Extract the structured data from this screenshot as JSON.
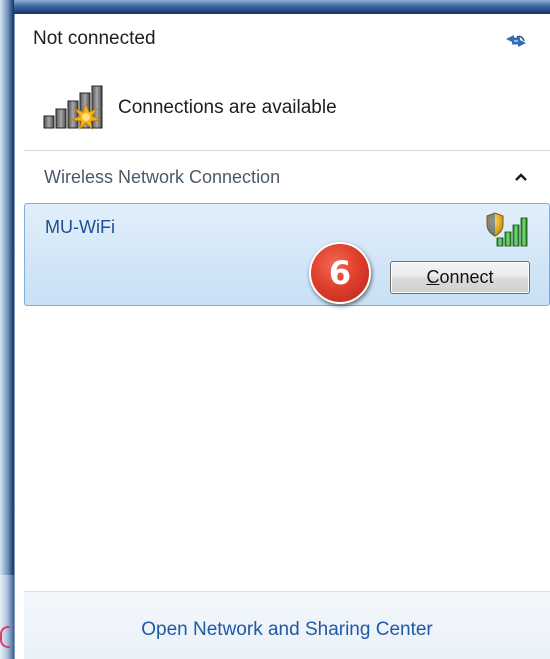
{
  "header": {
    "status_title": "Not connected",
    "availability_text": "Connections are available",
    "refresh_icon": "refresh-arrows-icon",
    "signal_icon": "signal-bars-starburst-icon"
  },
  "section": {
    "label": "Wireless Network Connection",
    "collapse_icon": "chevron-up-icon"
  },
  "networks": [
    {
      "name": "MU-WiFi",
      "signal_icon": "secured-signal-bars-icon",
      "connect_label_underlined": "C",
      "connect_label_rest": "onnect"
    }
  ],
  "annotation": {
    "step_number": "6",
    "color": "#e0402c"
  },
  "footer": {
    "link_label": "Open Network and Sharing Center"
  },
  "colors": {
    "selection": "#d3e6f8",
    "selection_border": "#84acdd",
    "link": "#1e5aa6",
    "network_name": "#1f4f8c"
  }
}
